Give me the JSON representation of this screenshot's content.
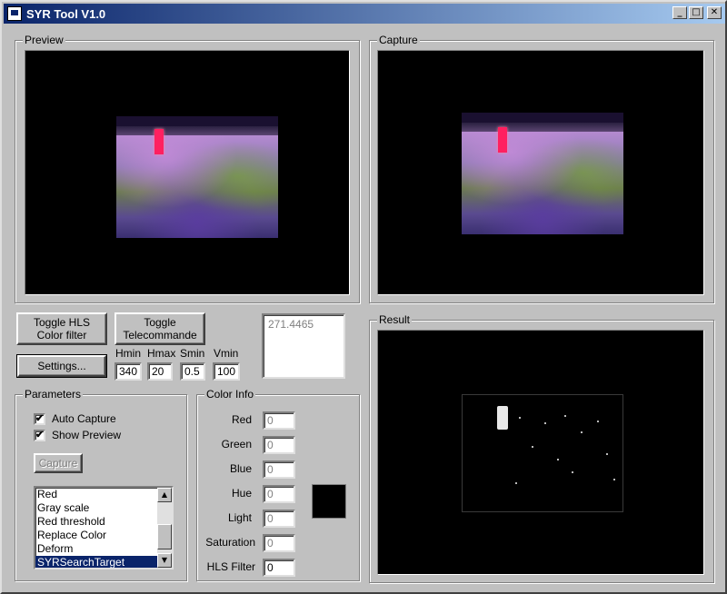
{
  "window": {
    "title": "SYR Tool V1.0",
    "minimize_glyph": "_",
    "maximize_glyph": "□",
    "close_glyph": "✕"
  },
  "preview": {
    "label": "Preview"
  },
  "capture": {
    "label": "Capture"
  },
  "result": {
    "label": "Result"
  },
  "buttons": {
    "toggle_hls": "Toggle HLS\nColor filter",
    "toggle_telecommande": "Toggle\nTelecommande",
    "settings": "Settings...",
    "capture": "Capture"
  },
  "hls": {
    "hmin_label": "Hmin",
    "hmin_value": "340",
    "hmax_label": "Hmax",
    "hmax_value": "20",
    "smin_label": "Smin",
    "smin_value": "0.5",
    "vmin_label": "Vmin",
    "vmin_value": "100"
  },
  "readout": {
    "value": "271.4465"
  },
  "parameters": {
    "label": "Parameters",
    "auto_capture": {
      "label": "Auto Capture",
      "checked": true
    },
    "show_preview": {
      "label": "Show Preview",
      "checked": true
    },
    "check_glyph": "✔",
    "filters": [
      {
        "label": "Red",
        "selected": false
      },
      {
        "label": "Gray scale",
        "selected": false
      },
      {
        "label": "Red threshold",
        "selected": false
      },
      {
        "label": "Replace Color",
        "selected": false
      },
      {
        "label": "Deform",
        "selected": false
      },
      {
        "label": "SYRSearchTarget",
        "selected": true
      }
    ],
    "scroll_up_glyph": "▲",
    "scroll_down_glyph": "▼"
  },
  "color_info": {
    "label": "Color Info",
    "red_label": "Red",
    "red_value": "0",
    "green_label": "Green",
    "green_value": "0",
    "blue_label": "Blue",
    "blue_value": "0",
    "hue_label": "Hue",
    "hue_value": "0",
    "light_label": "Light",
    "light_value": "0",
    "saturation_label": "Saturation",
    "saturation_value": "0",
    "hls_filter_label": "HLS Filter",
    "hls_filter_value": "0",
    "swatch_color": "#000000"
  },
  "colors": {
    "title_active": "#0a246a",
    "face": "#c0c0c0",
    "target": "#ff2060"
  }
}
